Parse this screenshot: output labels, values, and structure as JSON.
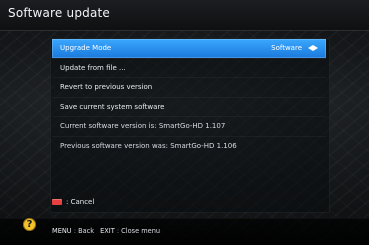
{
  "header": {
    "title": "Software update"
  },
  "menu": {
    "items": [
      {
        "label": "Upgrade Mode",
        "value": "Software"
      },
      {
        "label": "Update from file ..."
      },
      {
        "label": "Revert to previous version"
      },
      {
        "label": "Save current system software"
      },
      {
        "label": "Current software version is: SmartGo-HD 1.107"
      },
      {
        "label": "Previous software version was: SmartGo-HD 1.106"
      }
    ]
  },
  "hint": {
    "label": ": Cancel"
  },
  "footer": {
    "items": [
      {
        "key": "MENU",
        "label": "Back"
      },
      {
        "key": "EXIT",
        "label": "Close menu"
      }
    ]
  },
  "icons": {
    "help": "help-icon",
    "red_button": "red-button-icon",
    "left_arrow": "left-arrow-icon",
    "right_arrow": "right-arrow-icon"
  },
  "colors": {
    "accent_blue": "#2a8ff0",
    "cancel_red": "#e64040",
    "help_yellow": "#f3c22b"
  }
}
